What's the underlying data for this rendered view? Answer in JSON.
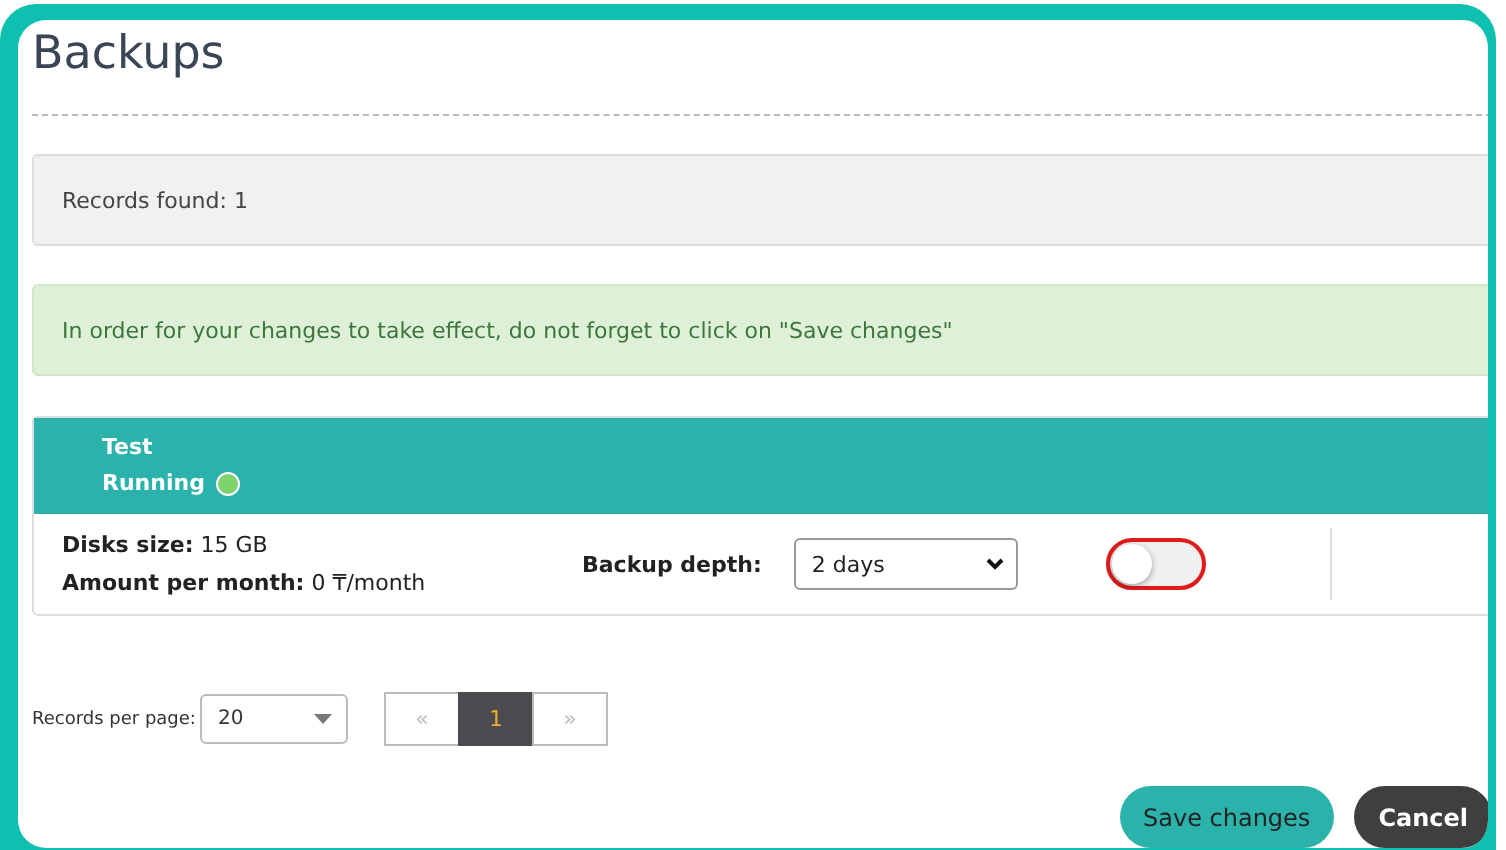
{
  "page": {
    "title": "Backups"
  },
  "records_found": {
    "label": "Records found:",
    "count": "1"
  },
  "notice": "In order for your changes to take effect, do not forget to click on \"Save changes\"",
  "record": {
    "name": "Test",
    "status": "Running",
    "disks_size": {
      "label": "Disks size:",
      "value": "15 GB"
    },
    "amount": {
      "label": "Amount per month:",
      "value": "0 ₸/month"
    },
    "backup_depth": {
      "label": "Backup depth:",
      "value": "2 days"
    },
    "toggle": {
      "on": false
    }
  },
  "pagination": {
    "label": "Records per page:",
    "per_page": "20",
    "prev": "«",
    "pages": [
      {
        "label": "1",
        "selected": true
      }
    ],
    "next": "»"
  },
  "buttons": [
    {
      "label": "Save changes",
      "kind": "primary"
    },
    {
      "label": "Cancel",
      "kind": "secondary"
    }
  ]
}
